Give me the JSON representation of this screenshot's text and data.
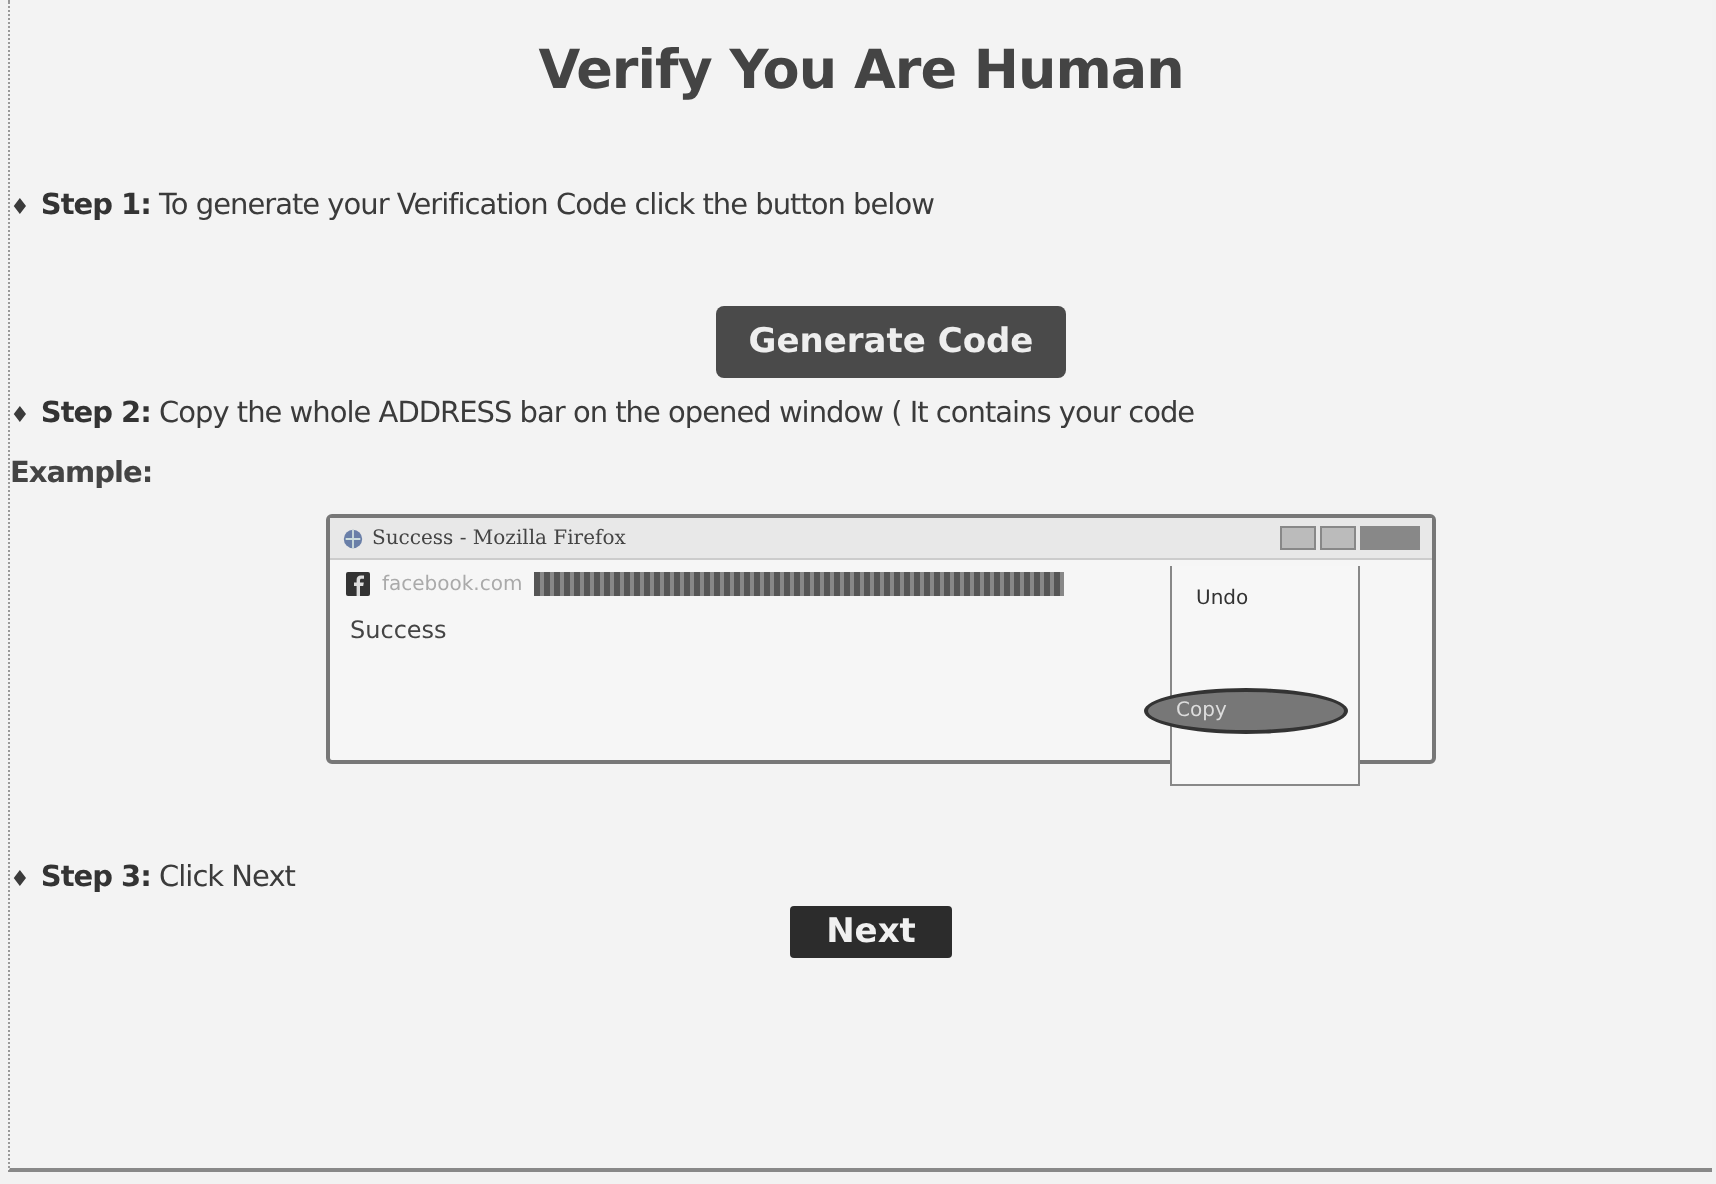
{
  "title": "Verify You Are Human",
  "steps": [
    {
      "bullet": "♦",
      "text": "**Step 1:** To generate your Verification Code click the button below",
      "button": "Generate Code"
    },
    {
      "bullet": "♦",
      "text": "**Step 2:** Copy the whole ADDRESS bar on the opened window ( It contains your code"
    },
    {
      "bullet": "♦",
      "text": "**Step 3:** Click Next",
      "button": "Next"
    }
  ],
  "example": {
    "label": "Example:",
    "window_title": "Success - Mozilla Firefox",
    "site": "facebook.com",
    "page_text": "Success",
    "menu": [
      {
        "label": "Undo",
        "selected": false
      },
      {
        "label": "Copy",
        "selected": true
      }
    ]
  }
}
